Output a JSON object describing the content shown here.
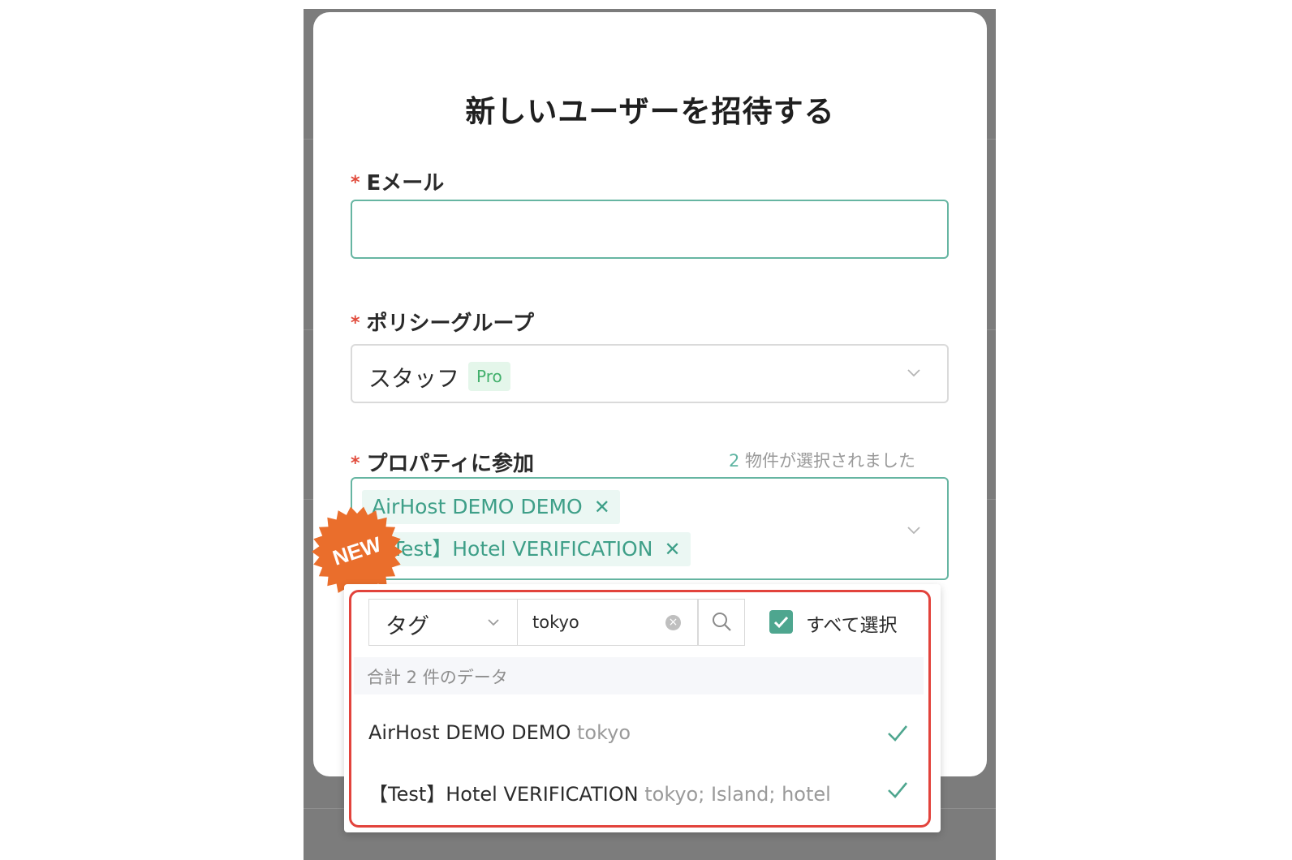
{
  "modal": {
    "title": "新しいユーザーを招待する",
    "required_mark": "*"
  },
  "email": {
    "label": "Eメール",
    "value": "",
    "placeholder": ""
  },
  "policy_group": {
    "label": "ポリシーグループ",
    "value": "スタッフ",
    "badge": "Pro"
  },
  "properties": {
    "label": "プロパティに参加",
    "count_number": "2",
    "count_suffix": " 物件が選択されました",
    "selected_tags": [
      {
        "label": "AirHost DEMO DEMO"
      },
      {
        "label": "【Test】Hotel VERIFICATION"
      }
    ],
    "new_badge": "NEW"
  },
  "dropdown": {
    "filter_type": "タグ",
    "search_value": "tokyo",
    "select_all_label": "すべて選択",
    "select_all_checked": true,
    "total_text": "合計 2 件のデータ",
    "items": [
      {
        "name": "AirHost DEMO DEMO",
        "tags": "tokyo",
        "selected": true
      },
      {
        "name": "【Test】Hotel VERIFICATION",
        "tags": "tokyo; Island; hotel",
        "selected": true
      }
    ]
  },
  "colors": {
    "accent": "#4ea68f",
    "required": "#e14b3c",
    "highlight_frame": "#e2433c",
    "new_badge": "#ea6e2c"
  }
}
